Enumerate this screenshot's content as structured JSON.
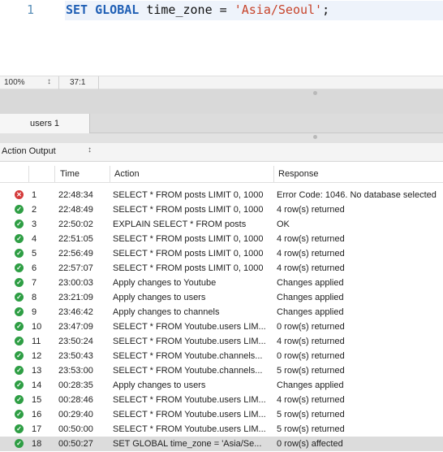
{
  "editor": {
    "line_number": "1",
    "code": {
      "kw1": "SET",
      "kw2": "GLOBAL",
      "plain1": "time_zone =",
      "str": "'Asia/Seoul'",
      "plain2": ";"
    }
  },
  "status_bar": {
    "zoom": "100%",
    "cursor": "37:1"
  },
  "tabs": [
    {
      "label": "users 1"
    }
  ],
  "output": {
    "selector": "Action Output",
    "columns": {
      "time": "Time",
      "action": "Action",
      "response": "Response"
    },
    "rows": [
      {
        "status": "error",
        "num": "1",
        "time": "22:48:34",
        "action": "SELECT * FROM posts LIMIT 0, 1000",
        "response": "Error Code: 1046. No database selected"
      },
      {
        "status": "ok",
        "num": "2",
        "time": "22:48:49",
        "action": "SELECT * FROM posts LIMIT 0, 1000",
        "response": "4 row(s) returned"
      },
      {
        "status": "ok",
        "num": "3",
        "time": "22:50:02",
        "action": "EXPLAIN SELECT * FROM posts",
        "response": "OK"
      },
      {
        "status": "ok",
        "num": "4",
        "time": "22:51:05",
        "action": "SELECT * FROM posts LIMIT 0, 1000",
        "response": "4 row(s) returned"
      },
      {
        "status": "ok",
        "num": "5",
        "time": "22:56:49",
        "action": "SELECT * FROM posts LIMIT 0, 1000",
        "response": "4 row(s) returned"
      },
      {
        "status": "ok",
        "num": "6",
        "time": "22:57:07",
        "action": "SELECT * FROM posts LIMIT 0, 1000",
        "response": "4 row(s) returned"
      },
      {
        "status": "ok",
        "num": "7",
        "time": "23:00:03",
        "action": "Apply changes to Youtube",
        "response": "Changes applied"
      },
      {
        "status": "ok",
        "num": "8",
        "time": "23:21:09",
        "action": "Apply changes to users",
        "response": "Changes applied"
      },
      {
        "status": "ok",
        "num": "9",
        "time": "23:46:42",
        "action": "Apply changes to channels",
        "response": "Changes applied"
      },
      {
        "status": "ok",
        "num": "10",
        "time": "23:47:09",
        "action": "SELECT * FROM Youtube.users LIM...",
        "response": "0 row(s) returned"
      },
      {
        "status": "ok",
        "num": "11",
        "time": "23:50:24",
        "action": "SELECT * FROM Youtube.users LIM...",
        "response": "4 row(s) returned"
      },
      {
        "status": "ok",
        "num": "12",
        "time": "23:50:43",
        "action": "SELECT * FROM Youtube.channels...",
        "response": "0 row(s) returned"
      },
      {
        "status": "ok",
        "num": "13",
        "time": "23:53:00",
        "action": "SELECT * FROM Youtube.channels...",
        "response": "5 row(s) returned"
      },
      {
        "status": "ok",
        "num": "14",
        "time": "00:28:35",
        "action": "Apply changes to users",
        "response": "Changes applied"
      },
      {
        "status": "ok",
        "num": "15",
        "time": "00:28:46",
        "action": "SELECT * FROM Youtube.users LIM...",
        "response": "4 row(s) returned"
      },
      {
        "status": "ok",
        "num": "16",
        "time": "00:29:40",
        "action": "SELECT * FROM Youtube.users LIM...",
        "response": "5 row(s) returned"
      },
      {
        "status": "ok",
        "num": "17",
        "time": "00:50:00",
        "action": "SELECT * FROM Youtube.users LIM...",
        "response": "5 row(s) returned"
      },
      {
        "status": "ok",
        "num": "18",
        "time": "00:50:27",
        "action": "SET GLOBAL time_zone = 'Asia/Se...",
        "response": "0 row(s) affected",
        "selected": true
      }
    ]
  },
  "colors": {
    "ok": "#2e9e44",
    "error": "#d43b3b",
    "keyword": "#1f5fb5",
    "string": "#c7442b"
  },
  "icons": {
    "ok": "check-circle-icon",
    "error": "x-circle-icon"
  }
}
